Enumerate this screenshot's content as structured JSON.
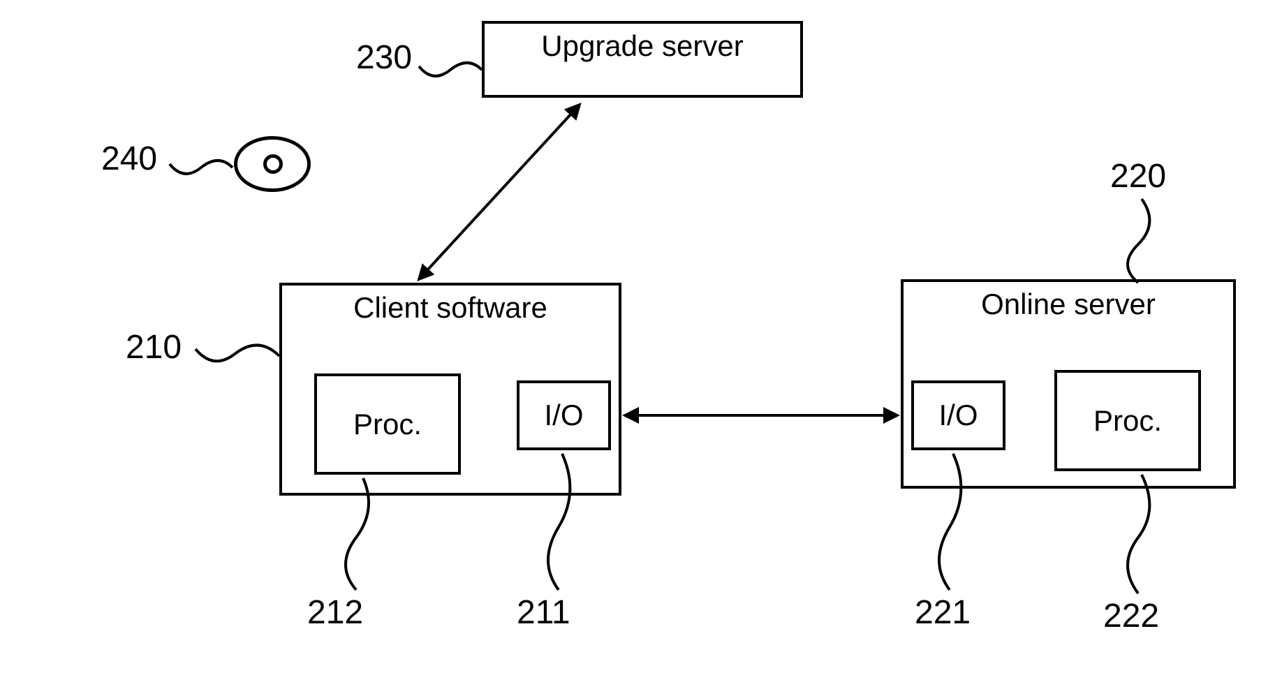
{
  "boxes": {
    "upgrade_server": {
      "title": "Upgrade server",
      "ref": "230"
    },
    "client_software": {
      "title": "Client software",
      "ref": "210",
      "proc": {
        "label": "Proc.",
        "ref": "212"
      },
      "io": {
        "label": "I/O",
        "ref": "211"
      }
    },
    "online_server": {
      "title": "Online server",
      "ref": "220",
      "io": {
        "label": "I/O",
        "ref": "221"
      },
      "proc": {
        "label": "Proc.",
        "ref": "222"
      }
    }
  },
  "disc": {
    "ref": "240"
  }
}
